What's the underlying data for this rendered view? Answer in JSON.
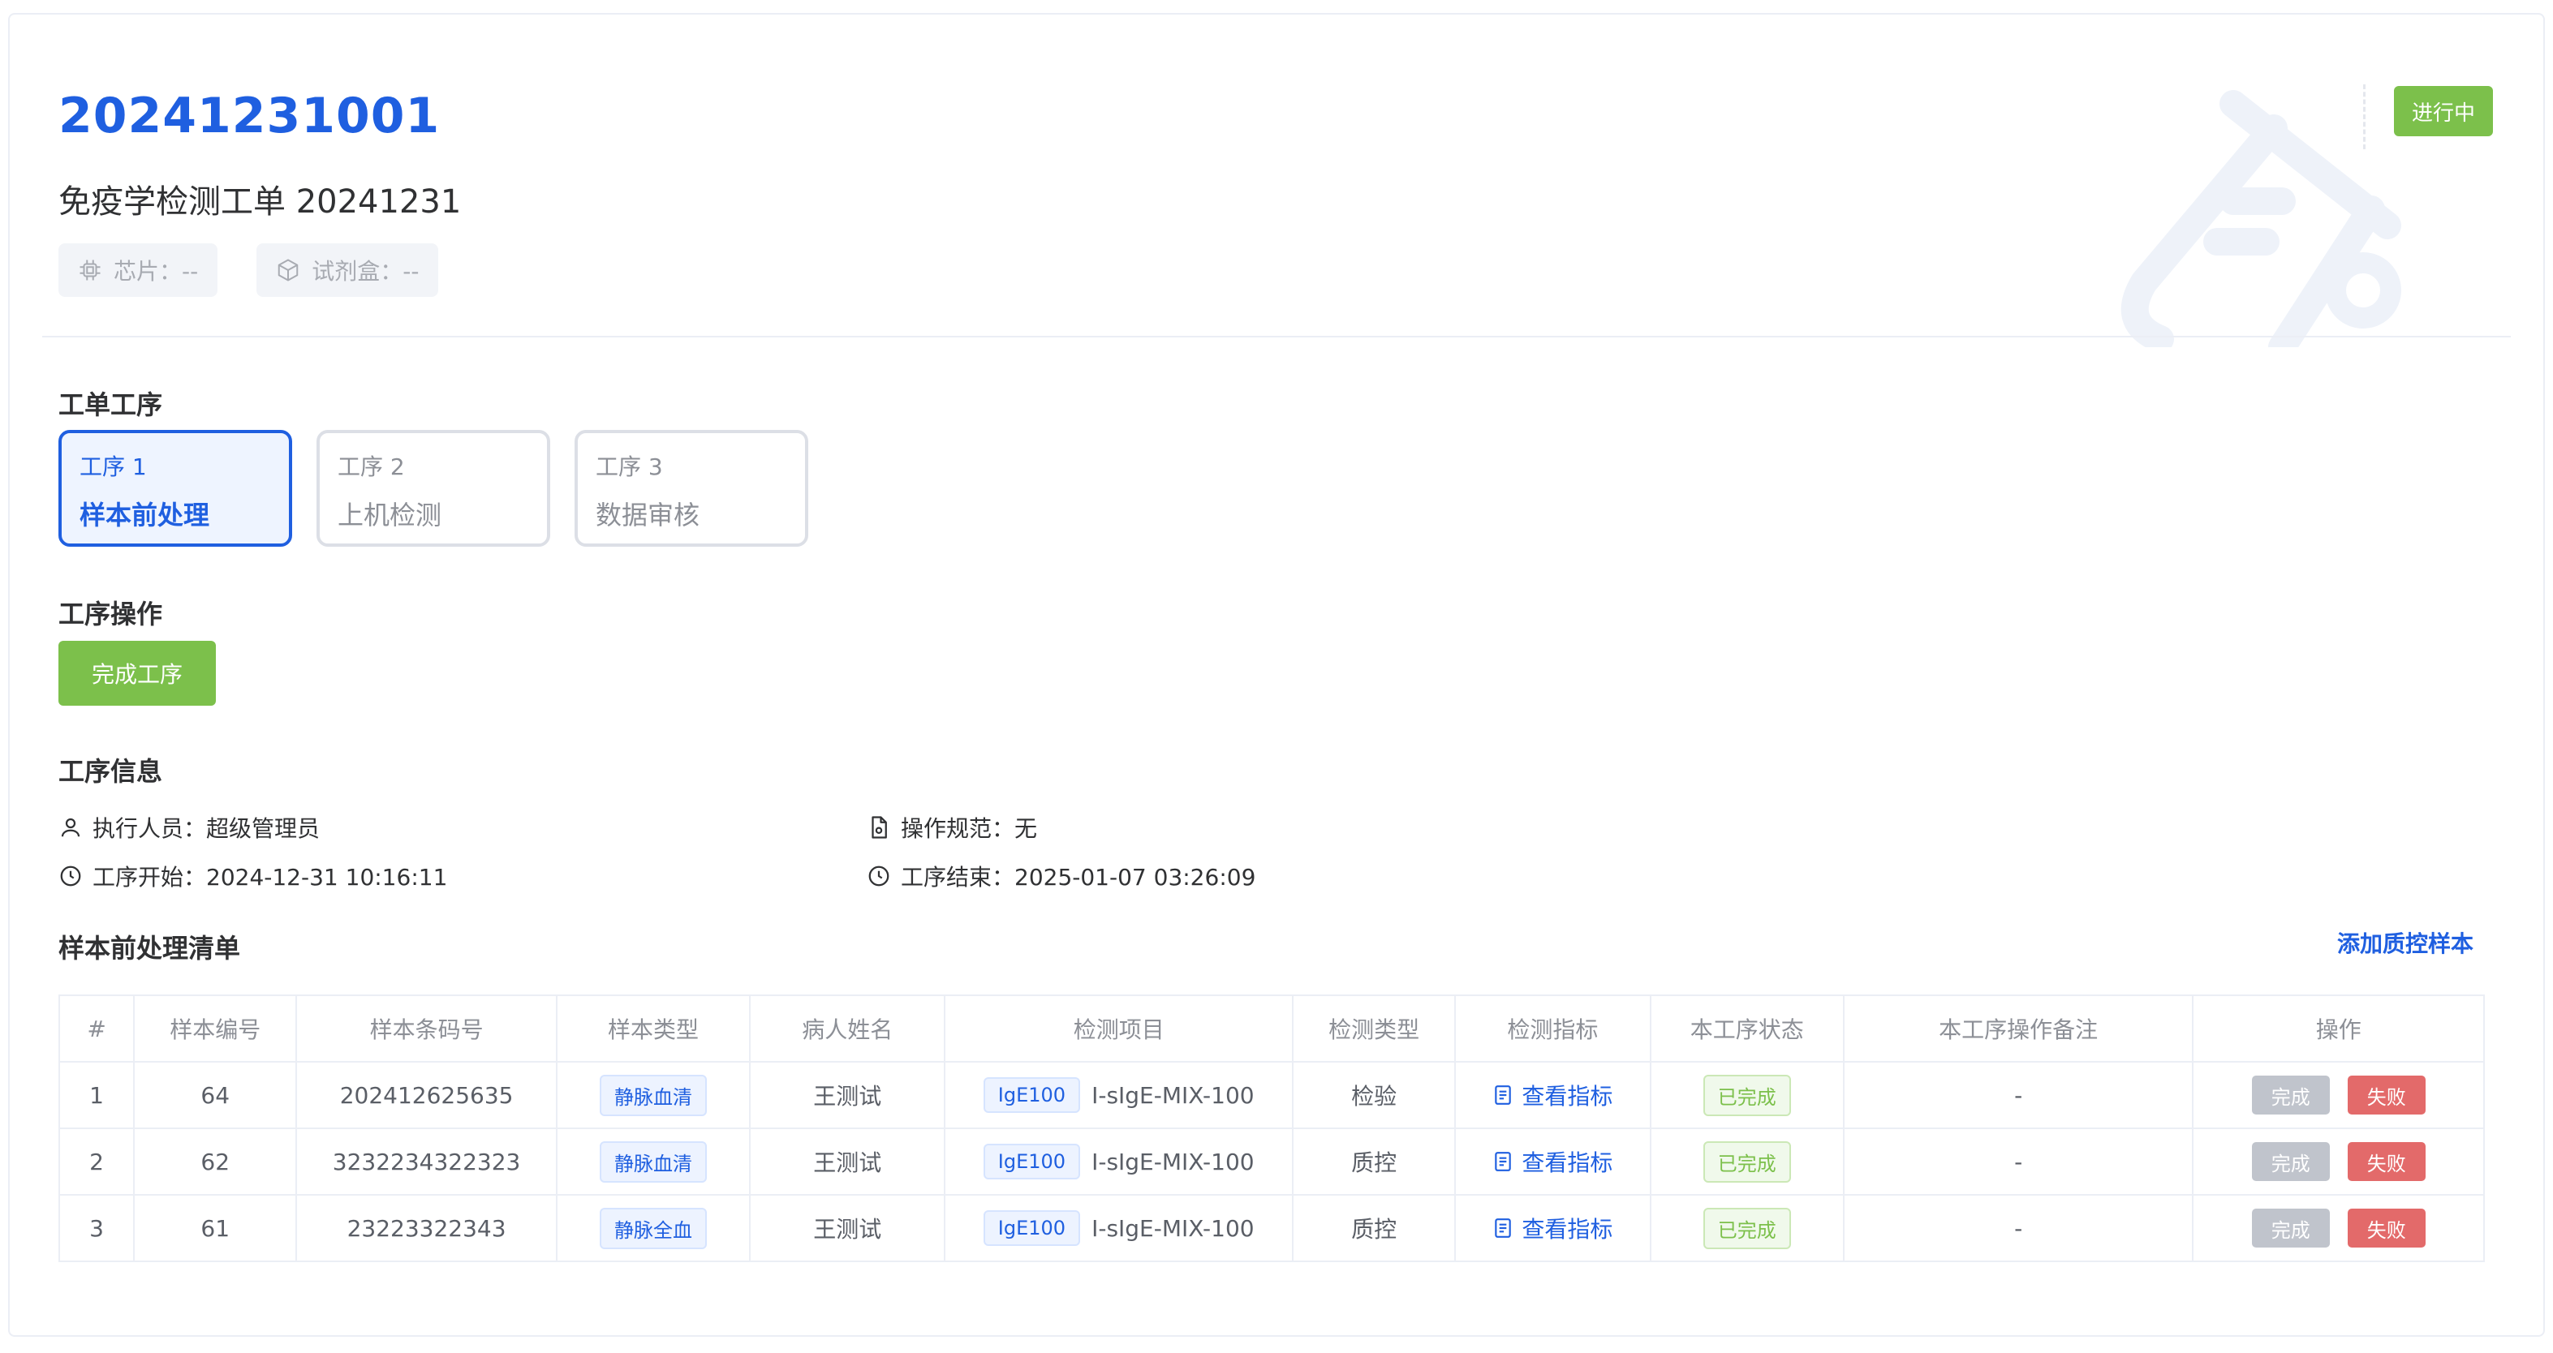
{
  "header": {
    "order_no": "20241231001",
    "order_name": "免疫学检测工单 20241231",
    "chips": [
      {
        "icon": "chip-icon",
        "label": "芯片：--"
      },
      {
        "icon": "box-icon",
        "label": "试剂盒：--"
      }
    ],
    "status": "进行中",
    "status_color": "#7cc04b"
  },
  "process": {
    "title": "工单工序",
    "steps": [
      {
        "no": "工序 1",
        "name": "样本前处理",
        "active": true
      },
      {
        "no": "工序 2",
        "name": "上机检测",
        "active": false
      },
      {
        "no": "工序 3",
        "name": "数据审核",
        "active": false
      }
    ]
  },
  "operation": {
    "title": "工序操作",
    "complete_label": "完成工序"
  },
  "info": {
    "title": "工序信息",
    "executor": "执行人员：超级管理员",
    "spec": "操作规范：无",
    "start": "工序开始：2024-12-31 10:16:11",
    "end": "工序结束：2025-01-07 03:26:09"
  },
  "list": {
    "title": "样本前处理清单",
    "add_qc_label": "添加质控样本",
    "columns": [
      "#",
      "样本编号",
      "样本条码号",
      "样本类型",
      "病人姓名",
      "检测项目",
      "检测类型",
      "检测指标",
      "本工序状态",
      "本工序操作备注",
      "操作"
    ],
    "rows": [
      {
        "idx": "1",
        "sample_no": "64",
        "barcode": "202412625635",
        "sample_type": "静脉血清",
        "patient": "王测试",
        "project_tag": "IgE100",
        "project_name": "I-sIgE-MIX-100",
        "test_type": "检验",
        "indicator": "查看指标",
        "status": "已完成",
        "remark": "-",
        "done": "完成",
        "fail": "失败"
      },
      {
        "idx": "2",
        "sample_no": "62",
        "barcode": "3232234322323",
        "sample_type": "静脉血清",
        "patient": "王测试",
        "project_tag": "IgE100",
        "project_name": "I-sIgE-MIX-100",
        "test_type": "质控",
        "indicator": "查看指标",
        "status": "已完成",
        "remark": "-",
        "done": "完成",
        "fail": "失败"
      },
      {
        "idx": "3",
        "sample_no": "61",
        "barcode": "23223322343",
        "sample_type": "静脉全血",
        "patient": "王测试",
        "project_tag": "IgE100",
        "project_name": "I-sIgE-MIX-100",
        "test_type": "质控",
        "indicator": "查看指标",
        "status": "已完成",
        "remark": "-",
        "done": "完成",
        "fail": "失败"
      }
    ]
  },
  "colors": {
    "primary": "#1f5fe0",
    "success": "#7cc04b",
    "danger": "#e36a6a",
    "muted": "#c0c4cc"
  }
}
